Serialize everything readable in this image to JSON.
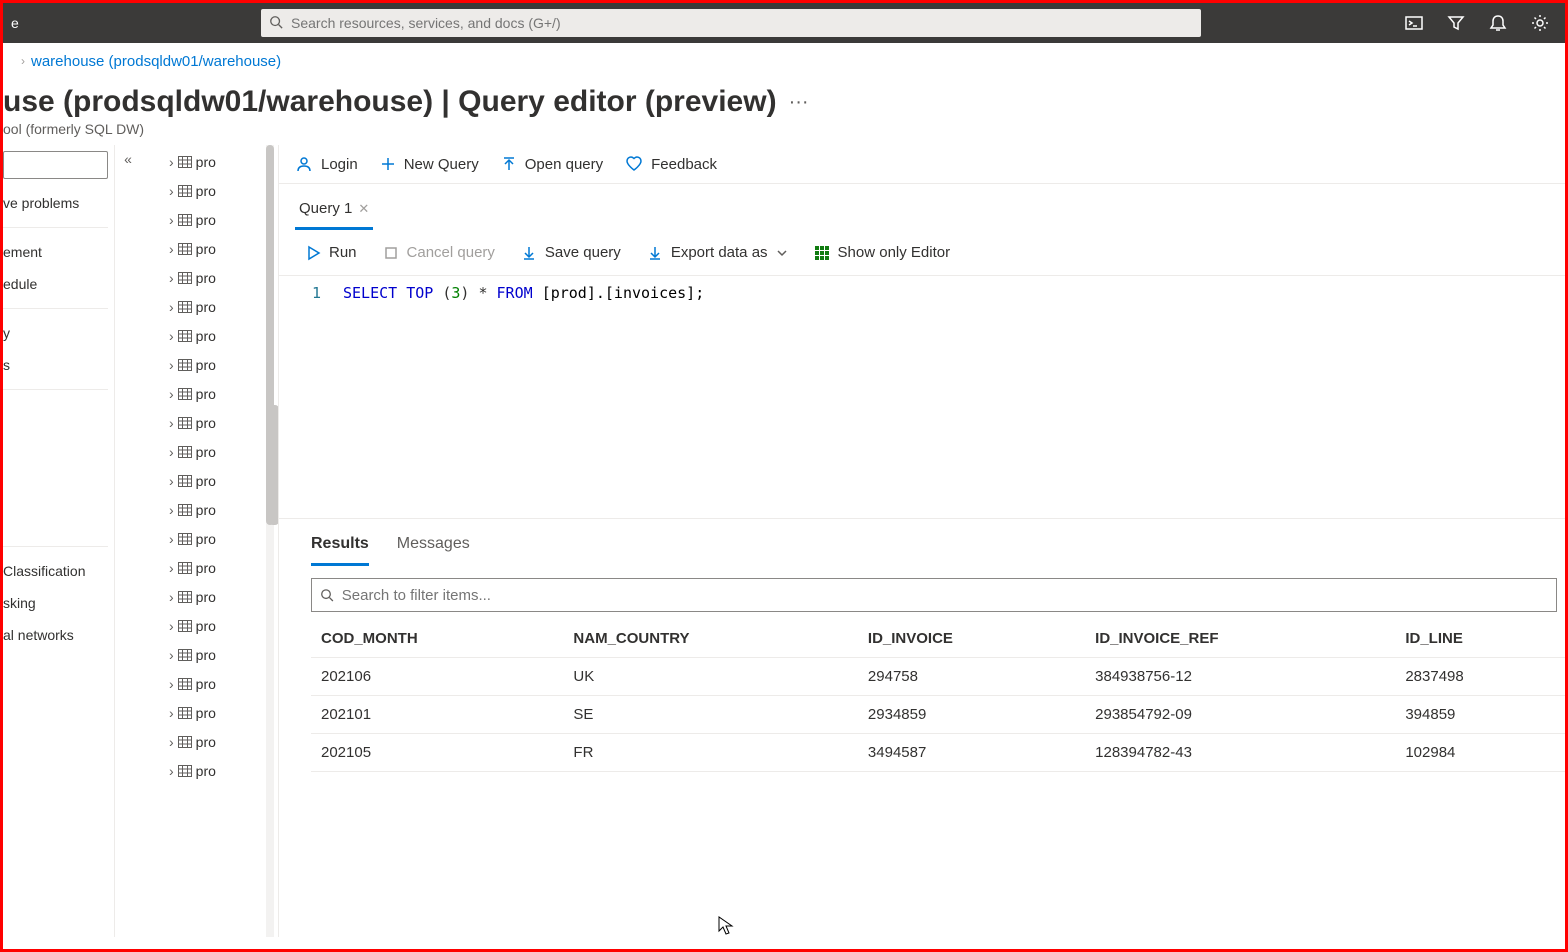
{
  "topbar": {
    "home_fragment": "e",
    "search_placeholder": "Search resources, services, and docs (G+/)"
  },
  "breadcrumb": {
    "link": "warehouse (prodsqldw01/warehouse)"
  },
  "page": {
    "title": "use (prodsqldw01/warehouse) | Query editor (preview)",
    "subtitle": "ool (formerly SQL DW)"
  },
  "leftnav": {
    "items_top": [
      "ve problems"
    ],
    "items_mid": [
      "ement",
      "edule"
    ],
    "items_mid2": [
      "y",
      "s"
    ],
    "items_bottom": [
      "Classification",
      "sking",
      "al networks"
    ]
  },
  "tree": {
    "item_label": "pro"
  },
  "toolbar": {
    "login": "Login",
    "new_query": "New Query",
    "open_query": "Open query",
    "feedback": "Feedback"
  },
  "query_tabs": {
    "tab1": "Query 1"
  },
  "actions": {
    "run": "Run",
    "cancel": "Cancel query",
    "save": "Save query",
    "export": "Export data as",
    "show_editor": "Show only Editor"
  },
  "editor": {
    "line_no": "1",
    "tokens": {
      "select": "SELECT",
      "top": "TOP",
      "lp": "(",
      "n": "3",
      "rp": ")",
      "star": "*",
      "from": "FROM",
      "tbl": "[prod].[invoices];"
    }
  },
  "results": {
    "tab_results": "Results",
    "tab_messages": "Messages",
    "filter_placeholder": "Search to filter items...",
    "columns": [
      "COD_MONTH",
      "NAM_COUNTRY",
      "ID_INVOICE",
      "ID_INVOICE_REF",
      "ID_LINE"
    ],
    "rows": [
      [
        "202106",
        "UK",
        "294758",
        "384938756-12",
        "2837498"
      ],
      [
        "202101",
        "SE",
        "2934859",
        "293854792-09",
        "394859"
      ],
      [
        "202105",
        "FR",
        "3494587",
        "128394782-43",
        "102984"
      ]
    ]
  }
}
